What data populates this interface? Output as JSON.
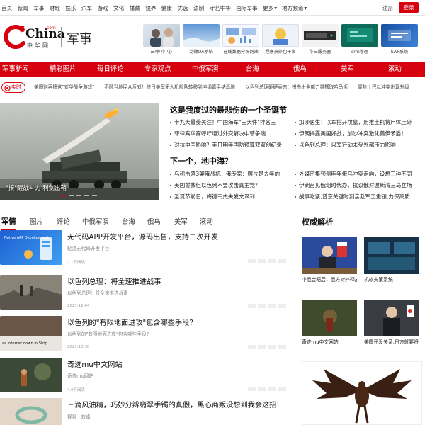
{
  "colors": {
    "brand_red": "#d6000f"
  },
  "top_nav": {
    "items": [
      "首页",
      "新闻",
      "军事",
      "财经",
      "娱乐",
      "汽车",
      "游戏",
      "文化",
      "播藏",
      "镜界",
      "健康",
      "优选",
      "法制",
      "守艺中华",
      "国际军事",
      "更多",
      "地方频道"
    ],
    "more_icon": "chevron-down-icon",
    "login_label": "注册",
    "register_label": "登录"
  },
  "logo": {
    "brand": "China",
    "com": ".com",
    "cn": "中华网",
    "section": "军事"
  },
  "ads": [
    {
      "caption": "云呼叫中心"
    },
    {
      "caption": "泛微OA系统"
    },
    {
      "caption": "在线数据分析网站"
    },
    {
      "caption": "程序员外包平台"
    },
    {
      "caption": "华三服务器"
    },
    {
      "caption": "crm管理"
    },
    {
      "caption": "SAP系统"
    }
  ],
  "red_nav": [
    "军事新闻",
    "精彩图片",
    "每日评论",
    "专家观点",
    "中俄军演",
    "台海",
    "俄乌",
    "美军",
    "滚动"
  ],
  "ticker": {
    "badge": "实时",
    "items": [
      "美国别再搞这\"对华战争游戏\"",
      "不顾当地民众反对！驻日美军无人机部队转移到冲绳嘉手纳基地",
      "以色列总理砸硬表态：将击出全部力量攫取哈马斯",
      "聚焦｜巴以冲突出现升级"
    ]
  },
  "hero": {
    "caption": "\"揍\"醒战斗力 利剑出鞘"
  },
  "headline1": "这是我度过的最悲伤的一个圣诞节",
  "news_group1": [
    "十九大最受关注！中国海军\"三大件\"排名三",
    "加沙医生：以军挖开坟墓，用推土机将尸体压碎",
    "菲律宾华裔呼吁通过外交解决中菲争端",
    "伊朗揭露美国好战，加沙冲突激化美伊矛盾！",
    "对抗中国影响？美日明年国防预算双双创纪录",
    "以色列总理：以军行动未受外部压力影响"
  ],
  "headline2": "下一个，地中海？",
  "news_group2": [
    "乌称击落3架俄战机，俄专家：照片是去年的",
    "外媒密集预测明年俄乌冲突走向，设想三种不同",
    "美国誓救但以色列不要攻击真主党？",
    "伊朗召见俄组时代办，抗议俄对波斯湾三岛立场",
    "圣诞节前日，梅德韦杰夫发文讽刺",
    "战事吃紧,普京关键时刻亲赴军工重镇,力保高质"
  ],
  "tabs": [
    "军情",
    "图片",
    "评论",
    "中俄军演",
    "台海",
    "俄乌",
    "美军",
    "滚动"
  ],
  "feed": [
    {
      "title": "无代码APP开发平台，源码出售，支持二次开发",
      "sub": "轻流无代码开发平台",
      "meta": "2.1万阅读",
      "img_text": "Native APP Development"
    },
    {
      "title": "以色列总理：将全速推进战事",
      "sub": "以色列总理：将全速推进战事",
      "meta": "2023-11-04",
      "img_text": ""
    },
    {
      "title": "以色列的\"有限地面进攻\"包含哪些手段？",
      "sub": "以色列的\"有限地面进攻\"包含哪些手段?",
      "meta": "2023-10-30",
      "img_text": "as Internet down in Strip"
    },
    {
      "title": "奇迹mu中文网站",
      "sub": "奇迹mu网站",
      "meta": "4.0万阅读",
      "img_text": ""
    },
    {
      "title": "三滴风油精，巧妙分辨翡翠手镯的真假，黑心商贩没想到我会这招!",
      "sub": "视频 · 效卓",
      "meta": "",
      "img_text": ""
    }
  ],
  "sidebar": {
    "title": "权威解析",
    "cards": [
      {
        "title": "中俄会晤后，俄方对外释放了明确期待，重点提"
      },
      {
        "title": "机软夫策系统"
      },
      {
        "title": "奇迹mu中文网站"
      },
      {
        "title": "美国迅没关系,日方就要将中国视作\"威胁\",但是在了"
      }
    ]
  }
}
